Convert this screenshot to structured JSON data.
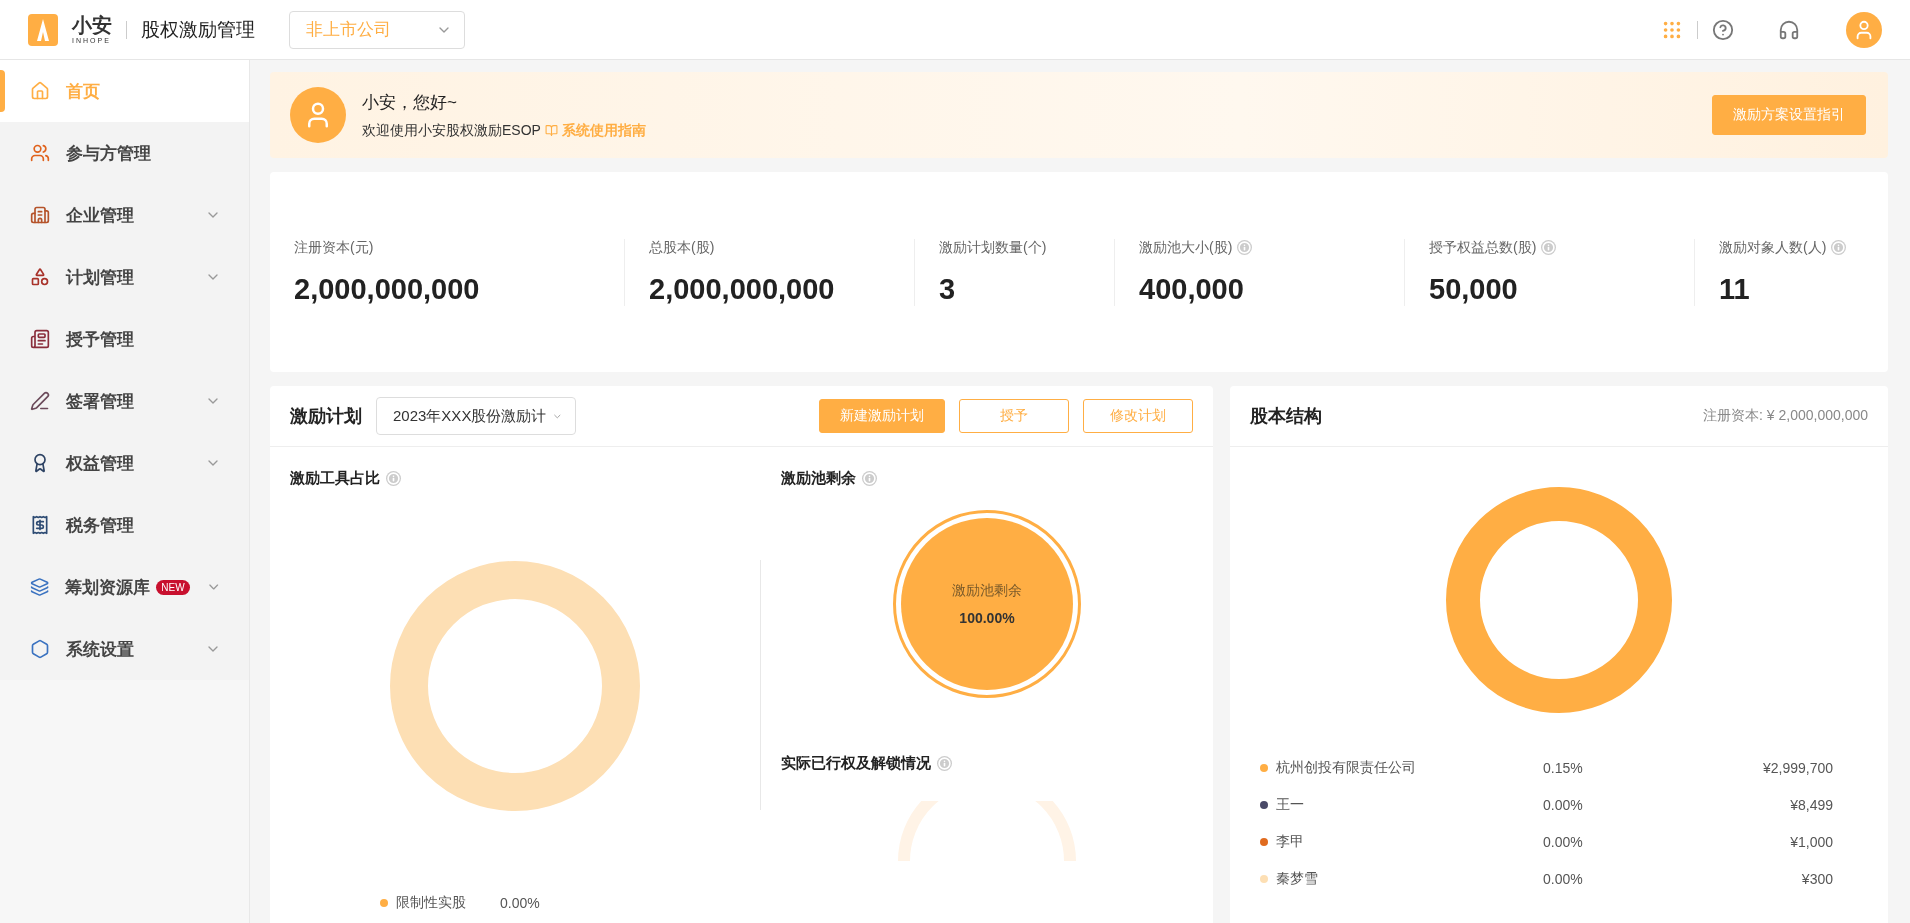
{
  "header": {
    "logo_text": "小安",
    "logo_subtext": "INHOPE",
    "app_title": "股权激励管理",
    "company_select": "非上市公司"
  },
  "sidebar": {
    "items": [
      {
        "label": "首页",
        "selected": true,
        "expandable": false
      },
      {
        "label": "参与方管理",
        "selected": false,
        "expandable": false
      },
      {
        "label": "企业管理",
        "selected": false,
        "expandable": true
      },
      {
        "label": "计划管理",
        "selected": false,
        "expandable": true
      },
      {
        "label": "授予管理",
        "selected": false,
        "expandable": false
      },
      {
        "label": "签署管理",
        "selected": false,
        "expandable": true
      },
      {
        "label": "权益管理",
        "selected": false,
        "expandable": true
      },
      {
        "label": "税务管理",
        "selected": false,
        "expandable": false
      },
      {
        "label": "筹划资源库",
        "selected": false,
        "expandable": true,
        "badge": "NEW"
      },
      {
        "label": "系统设置",
        "selected": false,
        "expandable": true
      }
    ]
  },
  "banner": {
    "greeting": "小安，您好~",
    "welcome": "欢迎使用小安股权激励ESOP",
    "guide_link": "系统使用指南",
    "button": "激励方案设置指引"
  },
  "stats": [
    {
      "label": "注册资本(元)",
      "value": "2,000,000,000",
      "info": false
    },
    {
      "label": "总股本(股)",
      "value": "2,000,000,000",
      "info": false
    },
    {
      "label": "激励计划数量(个)",
      "value": "3",
      "info": false
    },
    {
      "label": "激励池大小(股)",
      "value": "400,000",
      "info": true
    },
    {
      "label": "授予权益总数(股)",
      "value": "50,000",
      "info": true
    },
    {
      "label": "激励对象人数(人)",
      "value": "11",
      "info": true
    }
  ],
  "plan_panel": {
    "title": "激励计划",
    "plan_select": "2023年XXX股份激励计",
    "buttons": [
      {
        "label": "新建激励计划",
        "primary": true
      },
      {
        "label": "授予",
        "primary": false
      },
      {
        "label": "修改计划",
        "primary": false
      }
    ],
    "tool_ratio": {
      "title": "激励工具占比",
      "info": true,
      "legend": [
        {
          "label": "限制性实股",
          "value": "0.00%",
          "color": "#ffae44"
        }
      ]
    },
    "pool_remaining": {
      "title": "激励池剩余",
      "info": true,
      "center_label": "激励池剩余",
      "center_value": "100.00%"
    },
    "exercise_status": {
      "title": "实际已行权及解锁情况",
      "info": true
    }
  },
  "equity_panel": {
    "title": "股本结构",
    "capital": "注册资本: ¥ 2,000,000,000",
    "legend": [
      {
        "name": "杭州创投有限责任公司",
        "percent": "0.15%",
        "amount": "¥2,999,700",
        "color": "#ffae44"
      },
      {
        "name": "王一",
        "percent": "0.00%",
        "amount": "¥8,499",
        "color": "#4a4a68"
      },
      {
        "name": "李甲",
        "percent": "0.00%",
        "amount": "¥1,000",
        "color": "#e06b1f"
      },
      {
        "name": "秦梦雪",
        "percent": "0.00%",
        "amount": "¥300",
        "color": "#fddfb4"
      }
    ]
  }
}
